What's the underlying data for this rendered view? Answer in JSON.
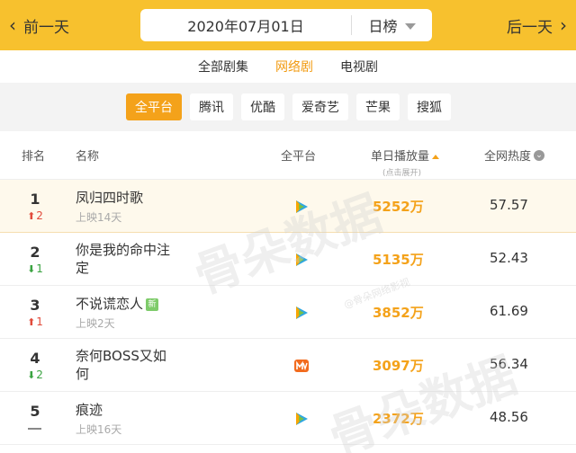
{
  "topbar": {
    "prev_label": "前一天",
    "next_label": "后一天",
    "date": "2020年07月01日",
    "period": "日榜"
  },
  "tabs": [
    {
      "label": "全部剧集",
      "active": false
    },
    {
      "label": "网络剧",
      "active": true
    },
    {
      "label": "电视剧",
      "active": false
    }
  ],
  "filters": [
    {
      "label": "全平台",
      "active": true
    },
    {
      "label": "腾讯",
      "active": false
    },
    {
      "label": "优酷",
      "active": false
    },
    {
      "label": "爱奇艺",
      "active": false
    },
    {
      "label": "芒果",
      "active": false
    },
    {
      "label": "搜狐",
      "active": false
    }
  ],
  "table_header": {
    "rank": "排名",
    "name": "名称",
    "platform": "全平台",
    "plays": "单日播放量",
    "plays_hint": "(点击展开)",
    "heat": "全网热度"
  },
  "rows": [
    {
      "rank": "1",
      "change": "2",
      "change_dir": "up",
      "title": "凤归四时歌",
      "days": "上映14天",
      "platform_icon": "tencent-video-icon",
      "plays": "5252万",
      "heat": "57.57"
    },
    {
      "rank": "2",
      "change": "1",
      "change_dir": "down",
      "title": "你是我的命中注定",
      "days": "",
      "platform_icon": "tencent-video-icon",
      "plays": "5135万",
      "heat": "52.43"
    },
    {
      "rank": "3",
      "change": "1",
      "change_dir": "up",
      "title": "不说谎恋人",
      "new_badge": "新",
      "days": "上映2天",
      "platform_icon": "tencent-video-icon",
      "plays": "3852万",
      "heat": "61.69"
    },
    {
      "rank": "4",
      "change": "2",
      "change_dir": "down",
      "title": "奈何BOSS又如何",
      "days": "",
      "platform_icon": "mango-tv-icon",
      "plays": "3097万",
      "heat": "56.34"
    },
    {
      "rank": "5",
      "change": "",
      "change_dir": "none",
      "title": "痕迹",
      "days": "上映16天",
      "platform_icon": "tencent-video-icon",
      "plays": "2372万",
      "heat": "48.56"
    }
  ],
  "watermark": {
    "main": "骨朵数据",
    "sub": "@骨朵网络影视"
  },
  "colors": {
    "brand_yellow": "#f7c12e",
    "accent_orange": "#f4a21a",
    "up_red": "#e14b3b",
    "down_green": "#3aa341"
  }
}
